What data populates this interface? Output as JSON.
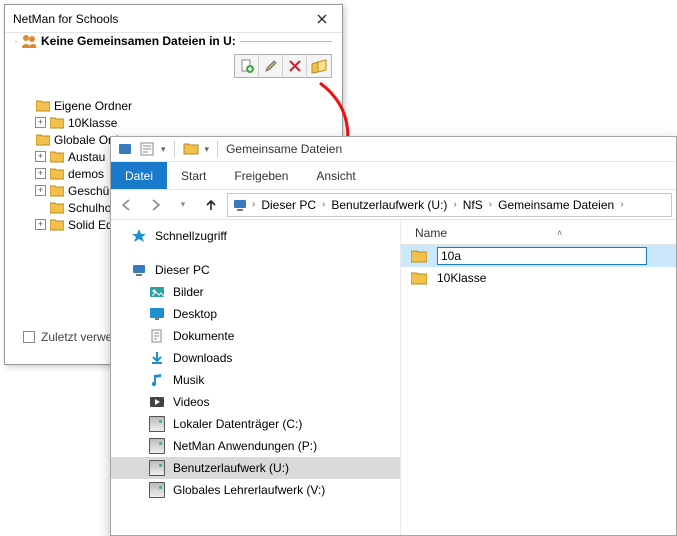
{
  "netman": {
    "title": "NetMan for Schools",
    "group_label": "Keine Gemeinsamen Dateien in U:",
    "toolbar": {
      "add": "add-file-icon",
      "edit": "pencil-icon",
      "delete": "delete-icon",
      "open": "open-external-icon"
    },
    "tree": {
      "root1": "Eigene Ordner",
      "root1_child1": "10Klasse",
      "root2": "Globale Ordner",
      "root2_child1": "Austau",
      "root2_child2": "demos",
      "root2_child3": "Geschü",
      "root2_child4": "Schulho",
      "root2_child5": "Solid Ed"
    },
    "zuletzt_label": "Zuletzt verwe"
  },
  "explorer": {
    "qat_title": "Gemeinsame Dateien",
    "tabs": {
      "datei": "Datei",
      "start": "Start",
      "freigeben": "Freigeben",
      "ansicht": "Ansicht"
    },
    "breadcrumb": [
      "Dieser PC",
      "Benutzerlaufwerk (U:)",
      "NfS",
      "Gemeinsame Dateien"
    ],
    "nav": {
      "schnellzugriff": "Schnellzugriff",
      "dieser_pc": "Dieser PC",
      "bilder": "Bilder",
      "desktop": "Desktop",
      "dokumente": "Dokumente",
      "downloads": "Downloads",
      "musik": "Musik",
      "videos": "Videos",
      "drive_c": "Lokaler Datenträger (C:)",
      "drive_p": "NetMan Anwendungen (P:)",
      "drive_u": "Benutzerlaufwerk (U:)",
      "drive_v": "Globales Lehrerlaufwerk (V:)"
    },
    "column_header": "Name",
    "rows": {
      "rename_value": "10a",
      "row2": "10Klasse"
    }
  }
}
